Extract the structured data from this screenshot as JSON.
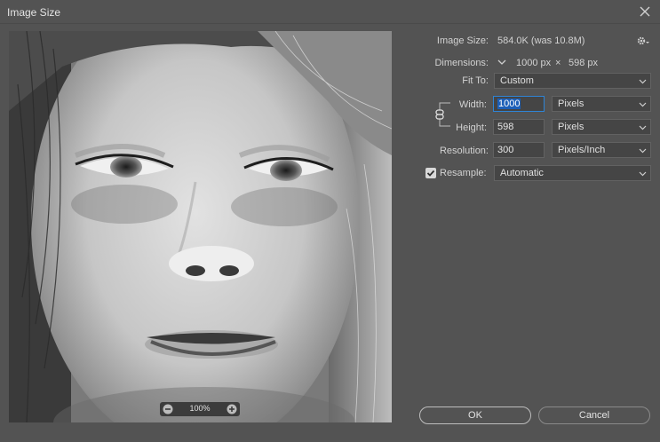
{
  "window": {
    "title": "Image Size"
  },
  "preview": {
    "zoom": "100%"
  },
  "image_size": {
    "label": "Image Size:",
    "value": "584.0K (was 10.8M)"
  },
  "dimensions": {
    "label": "Dimensions:",
    "width": "1000 px",
    "times": "×",
    "height": "598 px"
  },
  "fit_to": {
    "label": "Fit To:",
    "value": "Custom"
  },
  "width": {
    "label": "Width:",
    "value": "1000",
    "unit": "Pixels"
  },
  "height": {
    "label": "Height:",
    "value": "598",
    "unit": "Pixels"
  },
  "resolution": {
    "label": "Resolution:",
    "value": "300",
    "unit": "Pixels/Inch"
  },
  "resample": {
    "label": "Resample:",
    "checked": true,
    "value": "Automatic"
  },
  "buttons": {
    "ok": "OK",
    "cancel": "Cancel"
  }
}
